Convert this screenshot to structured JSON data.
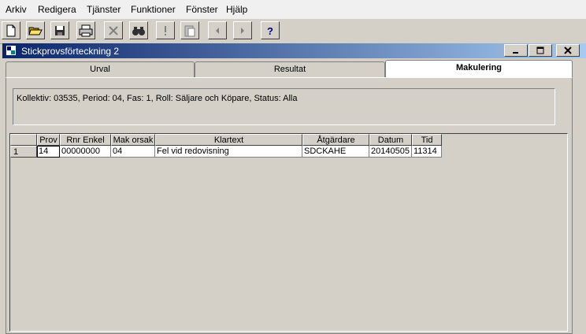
{
  "menu": [
    "Arkiv",
    "Redigera",
    "Tjänster",
    "Funktioner",
    "Fönster",
    "Hjälp"
  ],
  "window": {
    "title": "Stickprovsförteckning 2"
  },
  "tabs": [
    {
      "label": "Urval",
      "active": false
    },
    {
      "label": "Resultat",
      "active": false
    },
    {
      "label": "Makulering",
      "active": true
    }
  ],
  "info_text": "Kollektiv: 03535, Period: 04, Fas: 1, Roll: Säljare och Köpare, Status: Alla",
  "table": {
    "columns": [
      "Prov",
      "Rnr Enkel",
      "Mak orsak",
      "Klartext",
      "Åtgärdare",
      "Datum",
      "Tid"
    ],
    "rows": [
      {
        "num": "1",
        "cells": [
          "14",
          "00000000",
          "04",
          "Fel vid redovisning",
          "SDCKAHE",
          "20140505",
          "11314"
        ]
      }
    ]
  }
}
